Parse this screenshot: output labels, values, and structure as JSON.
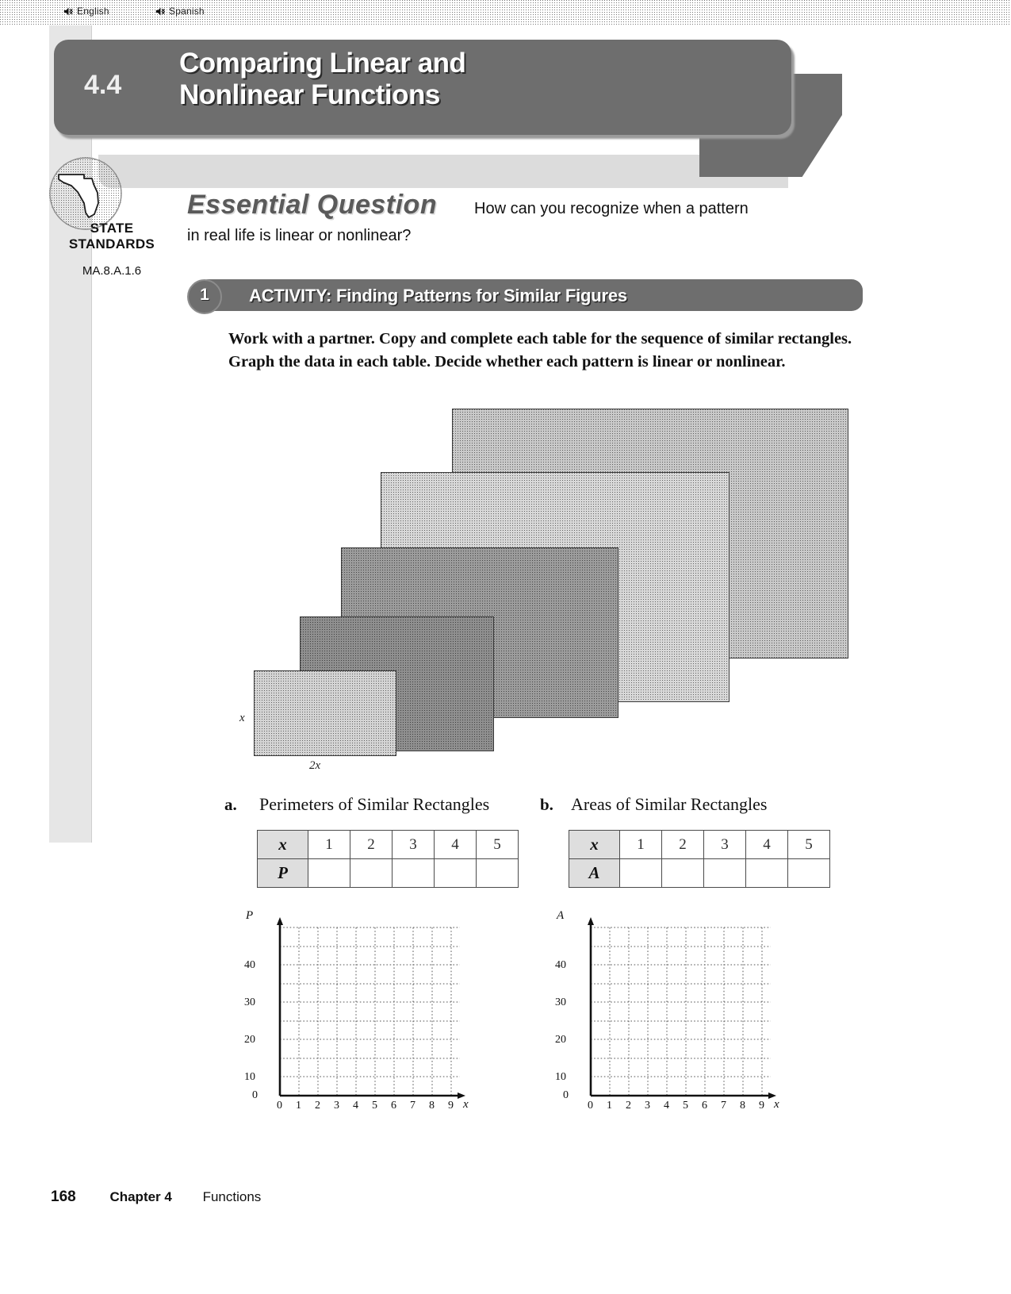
{
  "langbar": {
    "english": "English",
    "spanish": "Spanish",
    "icon": "speaker-icon"
  },
  "header": {
    "section_number": "4.4",
    "title_line1": "Comparing Linear and",
    "title_line2": "Nonlinear Functions"
  },
  "standards": {
    "icon": "florida-state-outline-icon",
    "label_line1": "STATE",
    "label_line2": "STANDARDS",
    "code": "MA.8.A.1.6"
  },
  "essential_question": {
    "heading": "Essential Question",
    "text_line1": "How can you recognize when a pattern",
    "text_line2": "in real life is linear or nonlinear?"
  },
  "activity": {
    "number": "1",
    "label": "ACTIVITY: Finding Patterns for Similar Figures",
    "body": "Work with a partner. Copy and complete each table for the sequence of similar rectangles. Graph the data in each table. Decide whether each pattern is linear or nonlinear."
  },
  "figure": {
    "label_height": "x",
    "label_width": "2x"
  },
  "parts": [
    {
      "letter": "a.",
      "title": "Perimeters of Similar Rectangles",
      "table": {
        "row_header_1": "x",
        "row_header_2": "P",
        "x_values": [
          "1",
          "2",
          "3",
          "4",
          "5"
        ],
        "y_values": [
          "",
          "",
          "",
          "",
          ""
        ]
      },
      "graph": {
        "y_axis_label": "P",
        "x_axis_label": "x",
        "y_ticks": [
          "0",
          "10",
          "20",
          "30",
          "40"
        ],
        "x_ticks": [
          "0",
          "1",
          "2",
          "3",
          "4",
          "5",
          "6",
          "7",
          "8",
          "9"
        ]
      }
    },
    {
      "letter": "b.",
      "title": "Areas of Similar Rectangles",
      "table": {
        "row_header_1": "x",
        "row_header_2": "A",
        "x_values": [
          "1",
          "2",
          "3",
          "4",
          "5"
        ],
        "y_values": [
          "",
          "",
          "",
          "",
          ""
        ]
      },
      "graph": {
        "y_axis_label": "A",
        "x_axis_label": "x",
        "y_ticks": [
          "0",
          "10",
          "20",
          "30",
          "40"
        ],
        "x_ticks": [
          "0",
          "1",
          "2",
          "3",
          "4",
          "5",
          "6",
          "7",
          "8",
          "9"
        ]
      }
    }
  ],
  "chart_data": [
    {
      "type": "scatter",
      "title": "Perimeters of Similar Rectangles",
      "xlabel": "x",
      "ylabel": "P",
      "xlim": [
        0,
        9
      ],
      "ylim": [
        0,
        45
      ],
      "x": [],
      "values": [],
      "x_ticks": [
        0,
        1,
        2,
        3,
        4,
        5,
        6,
        7,
        8,
        9
      ],
      "y_ticks": [
        0,
        10,
        20,
        30,
        40
      ],
      "grid": true,
      "legend": "none",
      "note": "empty grid for student plotting"
    },
    {
      "type": "scatter",
      "title": "Areas of Similar Rectangles",
      "xlabel": "x",
      "ylabel": "A",
      "xlim": [
        0,
        9
      ],
      "ylim": [
        0,
        45
      ],
      "x": [],
      "values": [],
      "x_ticks": [
        0,
        1,
        2,
        3,
        4,
        5,
        6,
        7,
        8,
        9
      ],
      "y_ticks": [
        0,
        10,
        20,
        30,
        40
      ],
      "grid": true,
      "legend": "none",
      "note": "empty grid for student plotting"
    }
  ],
  "sidebar": {
    "vertical_text": ""
  },
  "footer": {
    "page_number": "168",
    "chapter": "Chapter 4",
    "unit": "Functions"
  },
  "colors": {
    "banner": "#6e6e6e",
    "banner_text": "#ffffff",
    "table_header_fill": "#dedede",
    "page_background": "#ffffff"
  }
}
